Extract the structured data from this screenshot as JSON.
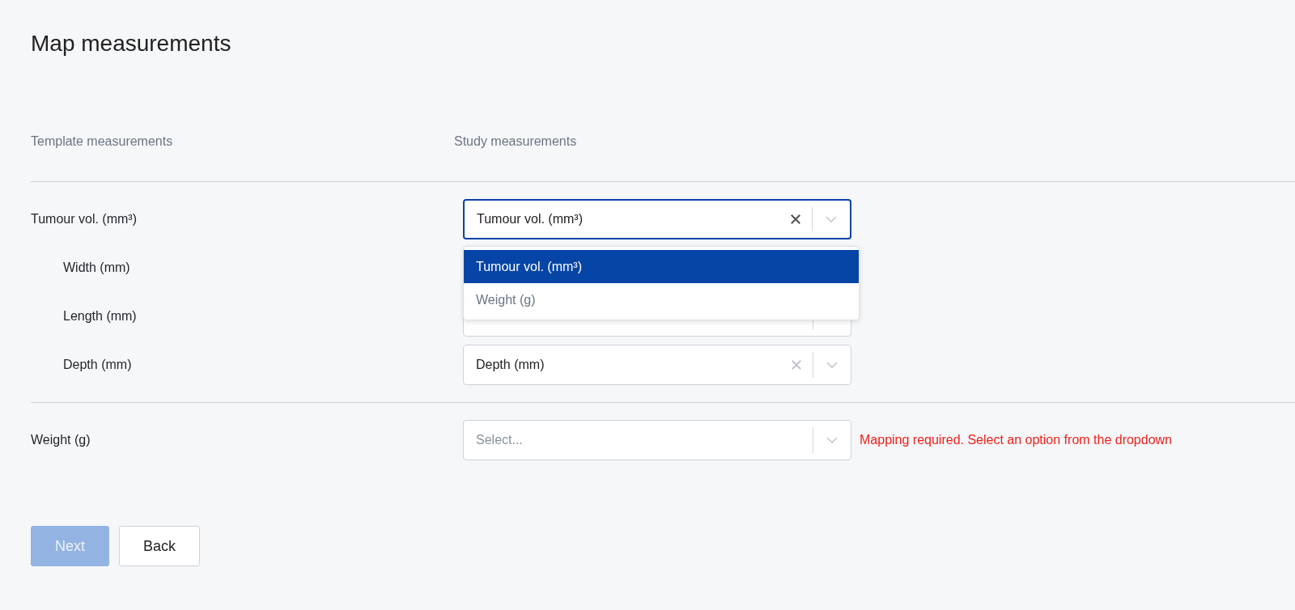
{
  "title": "Map measurements",
  "columns": [
    "Template measurements",
    "Study measurements"
  ],
  "groups": [
    {
      "label": "Tumour vol. (mm³)",
      "value": "Tumour vol. (mm³)",
      "focused": true,
      "menu": {
        "options": [
          {
            "label": "Tumour vol. (mm³)",
            "selected": true
          },
          {
            "label": "Weight (g)",
            "selected": false
          }
        ]
      },
      "children": [
        {
          "label": "Width (mm)"
        },
        {
          "label": "Length (mm)"
        },
        {
          "label": "Depth (mm)",
          "value": "Depth (mm)"
        }
      ]
    },
    {
      "label": "Weight (g)",
      "placeholder": "Select...",
      "error": "Mapping required. Select an option from the dropdown"
    }
  ],
  "buttons": [
    {
      "label": "Next",
      "kind": "primary",
      "disabled": true
    },
    {
      "label": "Back",
      "kind": "secondary"
    }
  ]
}
